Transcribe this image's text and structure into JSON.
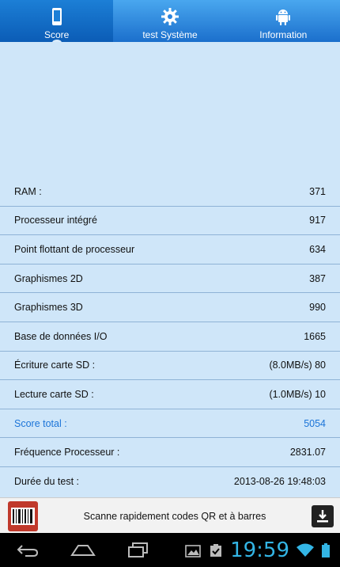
{
  "tabs": [
    {
      "label": "Score",
      "icon": "phone-icon",
      "active": true
    },
    {
      "label": "test Système",
      "icon": "gear-icon",
      "active": false
    },
    {
      "label": "Information",
      "icon": "android-icon",
      "active": false
    }
  ],
  "results": [
    {
      "label": "RAM :",
      "value": "371"
    },
    {
      "label": "Processeur intégré",
      "value": "917"
    },
    {
      "label": "Point flottant de processeur",
      "value": "634"
    },
    {
      "label": "Graphismes 2D",
      "value": "387"
    },
    {
      "label": "Graphismes 3D",
      "value": "990"
    },
    {
      "label": "Base de données I/O",
      "value": "1665"
    },
    {
      "label": "Écriture carte SD :",
      "value": "(8.0MB/s) 80"
    },
    {
      "label": "Lecture carte SD :",
      "value": "(1.0MB/s) 10"
    },
    {
      "label": "Score total :",
      "value": "5054"
    },
    {
      "label": "Fréquence Processeur :",
      "value": "2831.07"
    },
    {
      "label": "Durée du test :",
      "value": "2013-08-26 19:48:03"
    }
  ],
  "banner": {
    "text": "Scanne rapidement codes QR et à barres"
  },
  "status": {
    "time": "19:59"
  },
  "colors": {
    "accent": "#1b74d8",
    "clock": "#33b5e5",
    "background": "#cfe6f9"
  }
}
